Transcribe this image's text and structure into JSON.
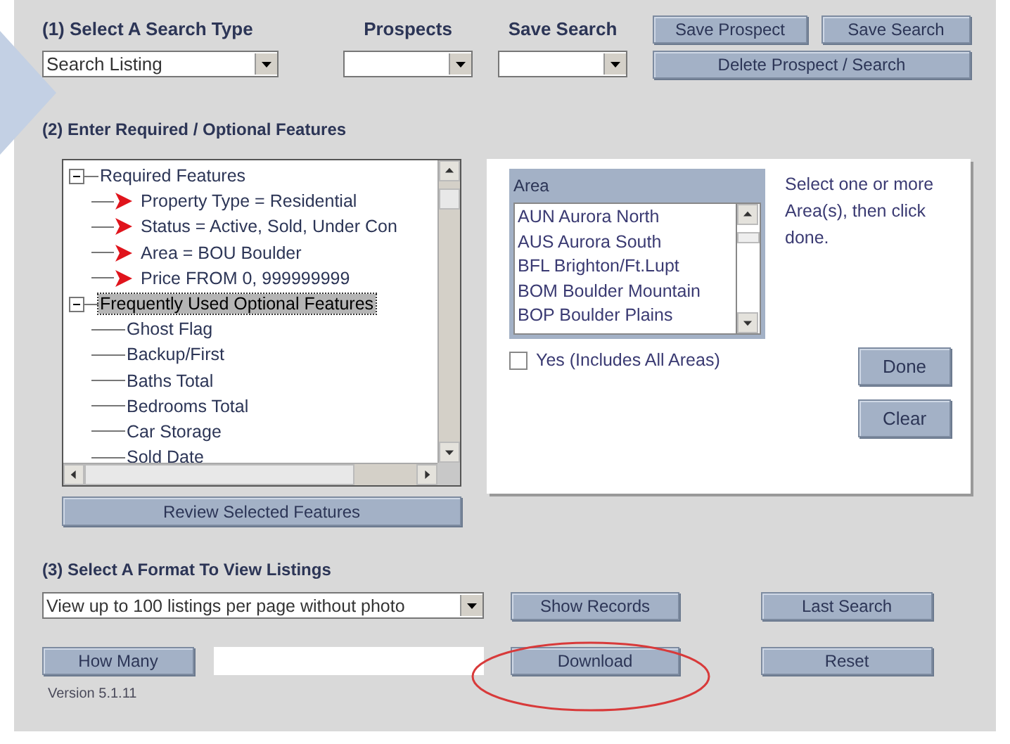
{
  "section1": {
    "title": "(1) Select A Search Type",
    "search_type": {
      "value": "Search Listing"
    },
    "prospects": {
      "label": "Prospects"
    },
    "save_search": {
      "label": "Save Search"
    },
    "buttons": [
      "Save Prospect",
      "Save Search",
      "Delete Prospect / Search"
    ]
  },
  "section2": {
    "title": "(2) Enter Required / Optional Features",
    "tree": [
      {
        "label": "Required Features",
        "expanded": true,
        "selected": false,
        "children": [
          {
            "label": "Property Type = Residential",
            "kind": "required",
            "selected": false
          },
          {
            "label": "Status = Active, Sold, Under Con",
            "kind": "required",
            "selected": false
          },
          {
            "label": "Area = BOU Boulder",
            "kind": "required",
            "selected": false
          },
          {
            "label": "Price FROM 0, 999999999",
            "kind": "required",
            "selected": false
          }
        ]
      },
      {
        "label": "Frequently Used Optional Features",
        "expanded": true,
        "selected": true,
        "children": [
          {
            "label": "Ghost Flag",
            "kind": "optional",
            "selected": false
          },
          {
            "label": "Backup/First",
            "kind": "optional",
            "selected": false
          },
          {
            "label": "Baths Total",
            "kind": "optional",
            "selected": false
          },
          {
            "label": "Bedrooms Total",
            "kind": "optional",
            "selected": false
          },
          {
            "label": "Car Storage",
            "kind": "optional",
            "selected": false
          },
          {
            "label": "Sold Date",
            "kind": "optional",
            "selected": false
          }
        ]
      }
    ],
    "review_button": "Review Selected Features",
    "area_panel": {
      "header": "Area",
      "items": [
        {
          "label": "AUN Aurora North",
          "selected": false
        },
        {
          "label": "AUS Aurora South",
          "selected": false
        },
        {
          "label": "BFL Brighton/Ft.Lupt",
          "selected": false
        },
        {
          "label": "BOM Boulder Mountain",
          "selected": false
        },
        {
          "label": "BOP Boulder Plains",
          "selected": false
        }
      ],
      "hint": "Select one or more Area(s), then click done.",
      "all_areas": {
        "label": "Yes (Includes All Areas)",
        "checked": false
      },
      "buttons": [
        "Done",
        "Clear"
      ]
    }
  },
  "section3": {
    "title": "(3) Select A Format To View Listings",
    "format": {
      "value": "View up to 100 listings per page without photo"
    },
    "buttons": [
      "Show Records",
      "Last Search",
      "How Many",
      "Download",
      "Reset"
    ]
  },
  "version": "Version 5.1.11"
}
